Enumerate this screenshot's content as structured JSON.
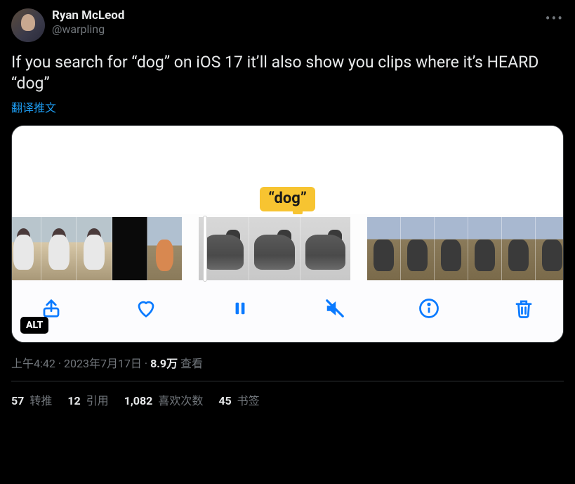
{
  "author": {
    "display_name": "Ryan McLeod",
    "handle": "@warpling"
  },
  "tweet_text": "If you search for “dog” on iOS 17 it’ll also show you clips where it’s HEARD “dog”",
  "translate_label": "翻译推文",
  "media": {
    "search_term_label": "“dog”",
    "alt_badge": "ALT",
    "toolbar_icons": [
      "share-icon",
      "heart-icon",
      "pause-icon",
      "mute-icon",
      "info-icon",
      "trash-icon"
    ]
  },
  "meta": {
    "time": "上午4:42",
    "sep1": " · ",
    "date": "2023年7月17日",
    "sep2": " · ",
    "views_number": "8.9万",
    "views_label": " 查看"
  },
  "stats": {
    "retweets": {
      "count": "57",
      "label": " 转推"
    },
    "quotes": {
      "count": "12",
      "label": " 引用"
    },
    "likes": {
      "count": "1,082",
      "label": " 喜欢次数"
    },
    "bookmarks": {
      "count": "45",
      "label": " 书签"
    }
  }
}
